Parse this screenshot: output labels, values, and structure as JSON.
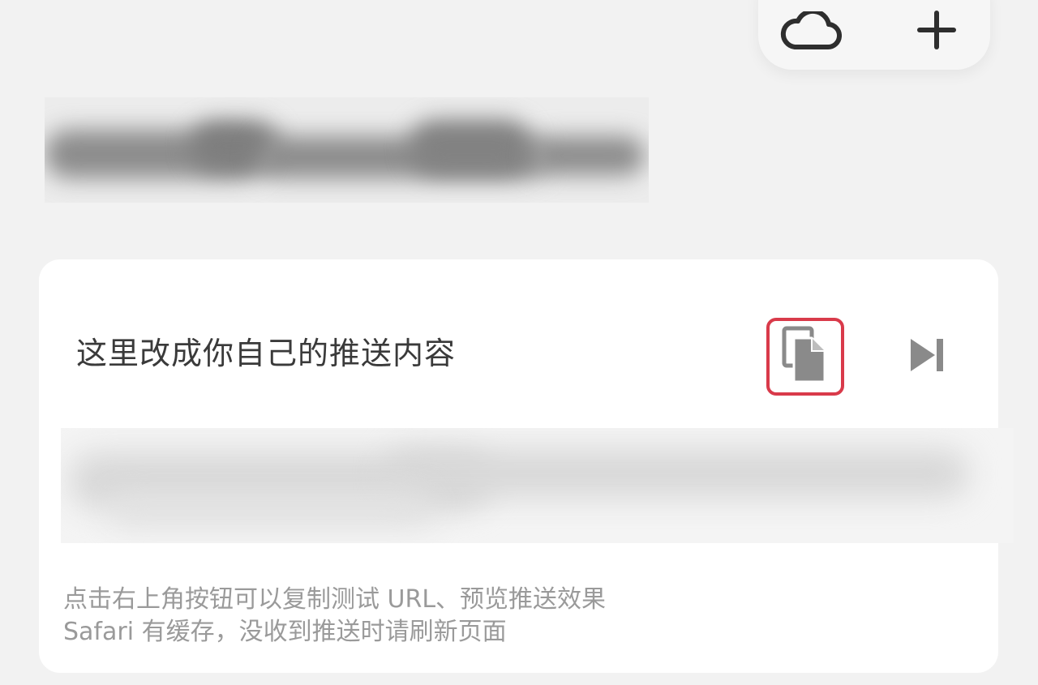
{
  "toolbar": {
    "cloud_icon": "cloud-icon",
    "add_icon": "plus-icon"
  },
  "card": {
    "title": "这里改成你自己的推送内容",
    "copy_icon": "copy-icon",
    "skip_icon": "skip-forward-icon",
    "hint_line1": "点击右上角按钮可以复制测试 URL、预览推送效果",
    "hint_line2": "Safari 有缓存，没收到推送时请刷新页面"
  },
  "colors": {
    "background": "#f2f2f2",
    "card": "#ffffff",
    "highlight_border": "#d93a4a",
    "icon_gray": "#8a8a8a",
    "text_primary": "#3a3a3a",
    "text_hint": "#9a9a9a"
  }
}
